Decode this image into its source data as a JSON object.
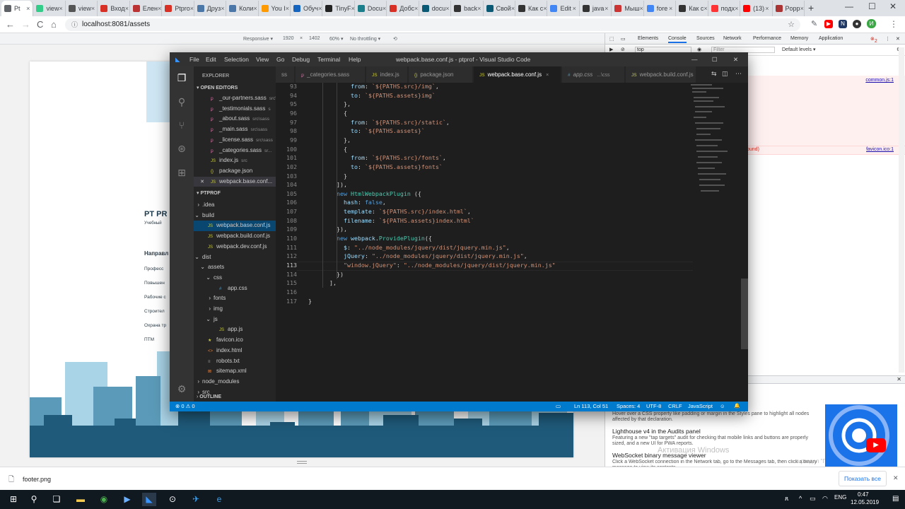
{
  "browser": {
    "tabs": [
      {
        "label": "Pt",
        "color": "#5f6368"
      },
      {
        "label": "view",
        "color": "#3c8"
      },
      {
        "label": "view",
        "color": "#555"
      },
      {
        "label": "Вход",
        "color": "#d93025"
      },
      {
        "label": "Елен",
        "color": "#b33"
      },
      {
        "label": "Ptpro",
        "color": "#d93025"
      },
      {
        "label": "Друз",
        "color": "#4a76a8"
      },
      {
        "label": "Коли",
        "color": "#4a76a8"
      },
      {
        "label": "You I",
        "color": "#f90"
      },
      {
        "label": "Обуч",
        "color": "#1565c0"
      },
      {
        "label": "TinyF",
        "color": "#222"
      },
      {
        "label": "Docu",
        "color": "#1a7f8a"
      },
      {
        "label": "Добс",
        "color": "#d93025"
      },
      {
        "label": "docu",
        "color": "#0b5a75"
      },
      {
        "label": "back",
        "color": "#333"
      },
      {
        "label": "Свой",
        "color": "#0b5a75"
      },
      {
        "label": "Как с",
        "color": "#333"
      },
      {
        "label": "Edit",
        "color": "#4285f4"
      },
      {
        "label": "java",
        "color": "#333"
      },
      {
        "label": "Мыш",
        "color": "#c33"
      },
      {
        "label": "fore",
        "color": "#4285f4"
      },
      {
        "label": "Как с",
        "color": "#333"
      },
      {
        "label": "подх",
        "color": "#f33"
      },
      {
        "label": "(13)",
        "color": "#f00"
      },
      {
        "label": "Popp",
        "color": "#a33"
      }
    ],
    "new_tab": "+",
    "win_min": "—",
    "win_max": "☐",
    "win_close": "✕",
    "url": "localhost:8081/assets",
    "back": "←",
    "forward": "→",
    "reload": "C",
    "home": "⌂",
    "profile_letter": "И"
  },
  "device_toolbar": {
    "mode": "Responsive ▾",
    "width": "1920",
    "x": "×",
    "height": "1402",
    "zoom": "60% ▾",
    "throttle": "No throttling ▾"
  },
  "site": {
    "logo_text": "PT PR",
    "logo_sub": "Учебный",
    "nav_title": "Направл",
    "nav_items": [
      "Професс",
      "Повышен",
      "Рабочие с",
      "Строител",
      "Охрана тр",
      "ПТМ"
    ]
  },
  "devtools": {
    "tabs": [
      "Elements",
      "Console",
      "Sources",
      "Network",
      "Performance",
      "Memory",
      "Application"
    ],
    "error_count": "2",
    "context": "top",
    "filter_placeholder": "Filter",
    "levels": "Default levels ▾",
    "link1": "common.js:1",
    "link2": "favicon.ico:1",
    "err_suffix": "ound)",
    "whatsnew_text1": "Hover over a CSS property like padding or margin in the Styles pane to highlight all nodes affected by that declaration.",
    "lighthouse_title": "Lighthouse v4 in the Audits panel",
    "lighthouse_text": "Featuring a new \"tap targets\" audit for checking that mobile links and buttons are properly sized, and a new UI for PWA reports.",
    "websocket_title": "WebSocket binary message viewer",
    "websocket_text": "Click a WebSocket connection in the Network tab, go to the Messages tab, then click a binary message to view its contents.",
    "watermark": "Активация Windows",
    "watermark_sub": "в раздел \"Параметры\""
  },
  "vscode": {
    "menu": [
      "File",
      "Edit",
      "Selection",
      "View",
      "Go",
      "Debug",
      "Terminal",
      "Help"
    ],
    "title": "webpack.base.conf.js - ptprof - Visual Studio Code",
    "explorer_title": "EXPLORER",
    "open_editors_title": "OPEN EDITORS",
    "open_editors": [
      {
        "icon": "ꝑ",
        "name": "_our-partners.sass",
        "hint": "src\\"
      },
      {
        "icon": "ꝑ",
        "name": "_testimonials.sass",
        "hint": "s"
      },
      {
        "icon": "ꝑ",
        "name": "_about.sass",
        "hint": "src\\sass"
      },
      {
        "icon": "ꝑ",
        "name": "_main.sass",
        "hint": "src\\sass"
      },
      {
        "icon": "ꝑ",
        "name": "_license.sass",
        "hint": "src\\sass"
      },
      {
        "icon": "ꝑ",
        "name": "_categories.sass",
        "hint": "sr..."
      },
      {
        "icon": "JS",
        "name": "index.js",
        "hint": "src"
      },
      {
        "icon": "{}",
        "name": "package.json",
        "hint": ""
      },
      {
        "icon": "JS",
        "name": "webpack.base.conf...",
        "hint": ""
      }
    ],
    "project_title": "PTPROF",
    "tree": [
      {
        "indent": 0,
        "arrow": "›",
        "icon": "",
        "name": ".idea"
      },
      {
        "indent": 0,
        "arrow": "⌄",
        "icon": "",
        "name": "build"
      },
      {
        "indent": 1,
        "arrow": "",
        "icon": "JS",
        "name": "webpack.base.conf.js"
      },
      {
        "indent": 1,
        "arrow": "",
        "icon": "JS",
        "name": "webpack.build.conf.js"
      },
      {
        "indent": 1,
        "arrow": "",
        "icon": "JS",
        "name": "webpack.dev.conf.js"
      },
      {
        "indent": 0,
        "arrow": "⌄",
        "icon": "",
        "name": "dist"
      },
      {
        "indent": 1,
        "arrow": "⌄",
        "icon": "",
        "name": "assets"
      },
      {
        "indent": 2,
        "arrow": "⌄",
        "icon": "",
        "name": "css"
      },
      {
        "indent": 3,
        "arrow": "",
        "icon": "#",
        "name": "app.css"
      },
      {
        "indent": 2,
        "arrow": "›",
        "icon": "",
        "name": "fonts"
      },
      {
        "indent": 2,
        "arrow": "›",
        "icon": "",
        "name": "img"
      },
      {
        "indent": 2,
        "arrow": "⌄",
        "icon": "",
        "name": "js"
      },
      {
        "indent": 3,
        "arrow": "",
        "icon": "JS",
        "name": "app.js"
      },
      {
        "indent": 1,
        "arrow": "",
        "icon": "★",
        "name": "favicon.ico"
      },
      {
        "indent": 1,
        "arrow": "",
        "icon": "<>",
        "name": "index.html"
      },
      {
        "indent": 1,
        "arrow": "",
        "icon": "≡",
        "name": "robots.txt"
      },
      {
        "indent": 1,
        "arrow": "",
        "icon": "⊠",
        "name": "sitemap.xml"
      },
      {
        "indent": 0,
        "arrow": "›",
        "icon": "",
        "name": "node_modules"
      },
      {
        "indent": 0,
        "arrow": "›",
        "icon": "",
        "name": "src"
      }
    ],
    "outline_title": "OUTLINE",
    "tabs": [
      {
        "icon": "",
        "name": "ss",
        "hint": ""
      },
      {
        "icon": "ꝑ",
        "name": "_categories.sass",
        "hint": ""
      },
      {
        "icon": "JS",
        "name": "index.js",
        "hint": ""
      },
      {
        "icon": "{}",
        "name": "package.json",
        "hint": ""
      },
      {
        "icon": "JS",
        "name": "webpack.base.conf.js",
        "hint": "×"
      },
      {
        "icon": "#",
        "name": "app.css",
        "hint": "...\\css"
      },
      {
        "icon": "JS",
        "name": "webpack.build.conf.js",
        "hint": ""
      }
    ],
    "code": [
      {
        "n": "93",
        "t": [
          [
            "            ",
            ""
          ],
          [
            "from",
            ""
          ],
          [
            ": ",
            "p"
          ],
          [
            "`${PATHS.src}/img`",
            "s"
          ],
          [
            ",",
            "p"
          ]
        ]
      },
      {
        "n": "94",
        "t": [
          [
            "            ",
            ""
          ],
          [
            "to",
            ""
          ],
          [
            ": ",
            "p"
          ],
          [
            "`${PATHS.assets}img`",
            "s"
          ]
        ]
      },
      {
        "n": "95",
        "t": [
          [
            "          },",
            "p"
          ]
        ]
      },
      {
        "n": "96",
        "t": [
          [
            "          {",
            "p"
          ]
        ]
      },
      {
        "n": "97",
        "t": [
          [
            "            ",
            ""
          ],
          [
            "from",
            ""
          ],
          [
            ": ",
            "p"
          ],
          [
            "`${PATHS.src}/static`",
            "s"
          ],
          [
            ",",
            "p"
          ]
        ]
      },
      {
        "n": "98",
        "t": [
          [
            "            ",
            ""
          ],
          [
            "to",
            ""
          ],
          [
            ": ",
            "p"
          ],
          [
            "`${PATHS.assets}`",
            "s"
          ]
        ]
      },
      {
        "n": "99",
        "t": [
          [
            "          },",
            "p"
          ]
        ]
      },
      {
        "n": "100",
        "t": [
          [
            "          {",
            "p"
          ]
        ]
      },
      {
        "n": "101",
        "t": [
          [
            "            ",
            ""
          ],
          [
            "from",
            ""
          ],
          [
            ": ",
            "p"
          ],
          [
            "`${PATHS.src}/fonts`",
            "s"
          ],
          [
            ",",
            "p"
          ]
        ]
      },
      {
        "n": "102",
        "t": [
          [
            "            ",
            ""
          ],
          [
            "to",
            ""
          ],
          [
            ": ",
            "p"
          ],
          [
            "`${PATHS.assets}fonts`",
            "s"
          ]
        ]
      },
      {
        "n": "103",
        "t": [
          [
            "          }",
            "p"
          ]
        ]
      },
      {
        "n": "104",
        "t": [
          [
            "        ]),",
            "p"
          ]
        ]
      },
      {
        "n": "105",
        "t": [
          [
            "        ",
            ""
          ],
          [
            "new ",
            "k"
          ],
          [
            "HtmlWebpackPlugin",
            "c"
          ],
          [
            " ({",
            "p"
          ]
        ]
      },
      {
        "n": "106",
        "t": [
          [
            "          ",
            ""
          ],
          [
            "hash",
            ""
          ],
          [
            ": ",
            "p"
          ],
          [
            "false",
            "k"
          ],
          [
            ",",
            "p"
          ]
        ]
      },
      {
        "n": "107",
        "t": [
          [
            "          ",
            ""
          ],
          [
            "template",
            ""
          ],
          [
            ": ",
            "p"
          ],
          [
            "`${PATHS.src}/index.html`",
            "s"
          ],
          [
            ",",
            "p"
          ]
        ]
      },
      {
        "n": "108",
        "t": [
          [
            "          ",
            ""
          ],
          [
            "filename",
            ""
          ],
          [
            ": ",
            "p"
          ],
          [
            "`${PATHS.assets}index.html`",
            "s"
          ]
        ]
      },
      {
        "n": "109",
        "t": [
          [
            "        }),",
            "p"
          ]
        ]
      },
      {
        "n": "110",
        "t": [
          [
            "        ",
            ""
          ],
          [
            "new ",
            "k"
          ],
          [
            "webpack",
            "v"
          ],
          [
            ".",
            "p"
          ],
          [
            "ProvidePlugin",
            "c"
          ],
          [
            "({",
            "p"
          ]
        ]
      },
      {
        "n": "111",
        "t": [
          [
            "          ",
            ""
          ],
          [
            "$",
            ""
          ],
          [
            ": ",
            "p"
          ],
          [
            "\"../node_modules/jquery/dist/jquery.min.js\"",
            "s"
          ],
          [
            ",",
            "p"
          ]
        ]
      },
      {
        "n": "112",
        "t": [
          [
            "          ",
            ""
          ],
          [
            "jQuery",
            ""
          ],
          [
            ": ",
            "p"
          ],
          [
            "\"../node_modules/jquery/dist/jquery.min.js\"",
            "s"
          ],
          [
            ",",
            "p"
          ]
        ]
      },
      {
        "n": "113",
        "t": [
          [
            "          ",
            ""
          ],
          [
            "\"window.jQuery\"",
            "s"
          ],
          [
            ": ",
            "p"
          ],
          [
            "\"../node_modules/jquery/dist/jquery.min.js\"",
            "s"
          ]
        ]
      },
      {
        "n": "114",
        "t": [
          [
            "        })",
            "p"
          ]
        ]
      },
      {
        "n": "115",
        "t": [
          [
            "      ],",
            "p"
          ]
        ]
      },
      {
        "n": "116",
        "t": [
          [
            "",
            ""
          ]
        ]
      },
      {
        "n": "117",
        "t": [
          [
            "}",
            "p"
          ]
        ]
      }
    ],
    "status": {
      "errors": "⊗ 0 ⚠ 0",
      "position": "Ln 113, Col 51",
      "spaces": "Spaces: 4",
      "encoding": "UTF-8",
      "eol": "CRLF",
      "language": "JavaScript",
      "smiley": "☺",
      "bell": "🔔"
    }
  },
  "downloads": {
    "file": "footer.png",
    "show_all": "Показать все",
    "close": "✕"
  },
  "taskbar": {
    "lang": "ENG",
    "time": "0:47",
    "date": "12.05.2019"
  },
  "colors": {
    "vs_blue": "#007acc",
    "skyline_light": "#9ec8dc",
    "skyline_mid": "#5b9ab8",
    "skyline_dark": "#1f5a7a"
  }
}
